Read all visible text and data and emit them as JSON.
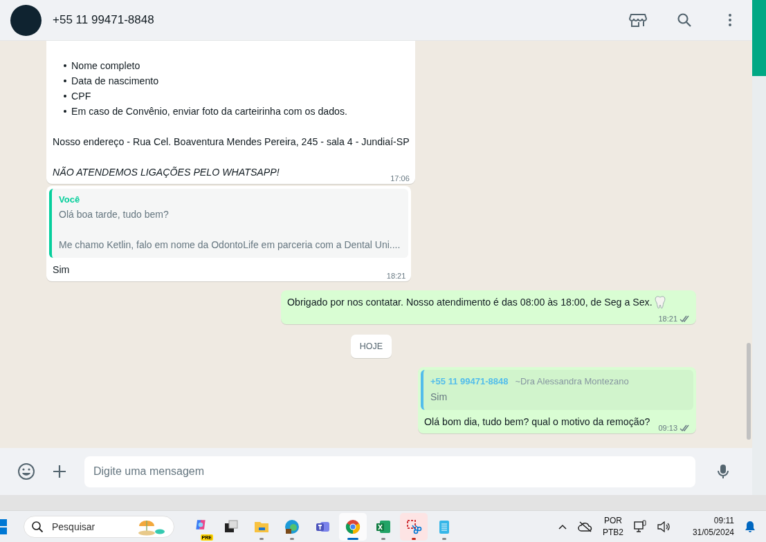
{
  "header": {
    "contact": "+55 11 99471-8848"
  },
  "messages": [
    {
      "kind": "incoming",
      "continues_above": true,
      "blocks": [
        {
          "kind": "list",
          "items": [
            "Nome completo",
            "Data de nascimento",
            "CPF",
            "Em caso de Convênio, enviar foto da carteirinha com os dados."
          ]
        },
        {
          "kind": "text",
          "text": "Nosso endereço - Rua Cel. Boaventura Mendes Pereira, 245 - sala 4 - Jundiaí-SP",
          "italic": false
        },
        {
          "kind": "text",
          "text": "NÃO ATENDEMOS LIGAÇÕES PELO WHATSAPP!",
          "italic": true
        }
      ],
      "time": "17:06"
    },
    {
      "kind": "incoming",
      "continues_above": false,
      "quote": {
        "author": "Você",
        "color": "#06cf9c",
        "lines": [
          "Olá boa tarde, tudo bem?",
          "Me chamo Ketlin, falo em nome da OdontoLife em parceria com a Dental Uni...."
        ]
      },
      "blocks": [
        {
          "kind": "text",
          "text": "Sim",
          "italic": false
        }
      ],
      "time": "18:21"
    },
    {
      "kind": "outgoing",
      "read": false,
      "trailing_emoji": true,
      "blocks": [
        {
          "kind": "text",
          "text": "Obrigado por nos contatar. Nosso atendimento é das 08:00 às 18:00, de Seg a Sex.",
          "italic": false
        }
      ],
      "time": "18:21"
    },
    {
      "kind": "date",
      "label": "HOJE"
    },
    {
      "kind": "outgoing",
      "read": false,
      "trailing_emoji": false,
      "quote": {
        "author": "+55 11 99471-8848",
        "pushname": "~Dra Alessandra Montezano",
        "color": "#53bdeb",
        "lines": [
          "Sim"
        ]
      },
      "blocks": [
        {
          "kind": "text",
          "text": "Olá bom dia, tudo bem? qual o motivo da remoção?",
          "italic": false
        }
      ],
      "time": "09:13"
    }
  ],
  "composer": {
    "placeholder": "Digite uma mensagem"
  },
  "taskbar": {
    "search_placeholder": "Pesquisar",
    "apps": [
      {
        "kind": "copilot",
        "badge": "PRE",
        "running": false,
        "selected": false,
        "flashing": false
      },
      {
        "kind": "taskview",
        "running": false,
        "selected": false,
        "flashing": false
      },
      {
        "kind": "explorer",
        "running": true,
        "selected": false,
        "flashing": false
      },
      {
        "kind": "edge",
        "running": true,
        "selected": false,
        "flashing": false
      },
      {
        "kind": "teams",
        "running": false,
        "selected": false,
        "flashing": false
      },
      {
        "kind": "chrome",
        "running": true,
        "selected": true,
        "flashing": false
      },
      {
        "kind": "excel",
        "running": true,
        "selected": false,
        "flashing": false
      },
      {
        "kind": "snipping",
        "running": true,
        "selected": false,
        "flashing": true
      },
      {
        "kind": "notepad",
        "running": true,
        "selected": false,
        "flashing": false
      }
    ],
    "tray": {
      "language": "POR",
      "layout": "PTB2",
      "time": "09:11",
      "date": "31/05/2024"
    }
  }
}
